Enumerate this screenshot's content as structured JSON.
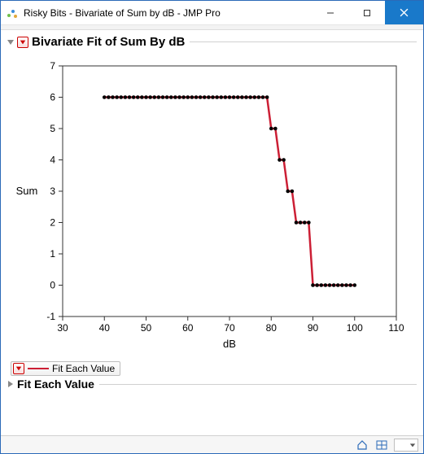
{
  "window": {
    "title": "Risky Bits - Bivariate of Sum by dB - JMP Pro"
  },
  "panel": {
    "title": "Bivariate Fit of Sum By dB"
  },
  "legend": {
    "fit_label": "Fit Each Value"
  },
  "subpanel": {
    "title": "Fit Each Value"
  },
  "chart_data": {
    "type": "line",
    "xlabel": "dB",
    "ylabel": "Sum",
    "xlim": [
      30,
      110
    ],
    "ylim": [
      -1,
      7
    ],
    "xticks": [
      30,
      40,
      50,
      60,
      70,
      80,
      90,
      100,
      110
    ],
    "yticks": [
      -1,
      0,
      1,
      2,
      3,
      4,
      5,
      6,
      7
    ],
    "series": [
      {
        "name": "Fit Each Value",
        "color": "#cc1f35",
        "x": [
          40,
          41,
          42,
          43,
          44,
          45,
          46,
          47,
          48,
          49,
          50,
          51,
          52,
          53,
          54,
          55,
          56,
          57,
          58,
          59,
          60,
          61,
          62,
          63,
          64,
          65,
          66,
          67,
          68,
          69,
          70,
          71,
          72,
          73,
          74,
          75,
          76,
          77,
          78,
          79,
          80,
          81,
          82,
          83,
          84,
          85,
          86,
          87,
          88,
          89,
          90,
          91,
          92,
          93,
          94,
          95,
          96,
          97,
          98,
          99,
          100
        ],
        "y": [
          6,
          6,
          6,
          6,
          6,
          6,
          6,
          6,
          6,
          6,
          6,
          6,
          6,
          6,
          6,
          6,
          6,
          6,
          6,
          6,
          6,
          6,
          6,
          6,
          6,
          6,
          6,
          6,
          6,
          6,
          6,
          6,
          6,
          6,
          6,
          6,
          6,
          6,
          6,
          6,
          5,
          5,
          4,
          4,
          3,
          3,
          2,
          2,
          2,
          2,
          0,
          0,
          0,
          0,
          0,
          0,
          0,
          0,
          0,
          0,
          0
        ]
      }
    ]
  }
}
